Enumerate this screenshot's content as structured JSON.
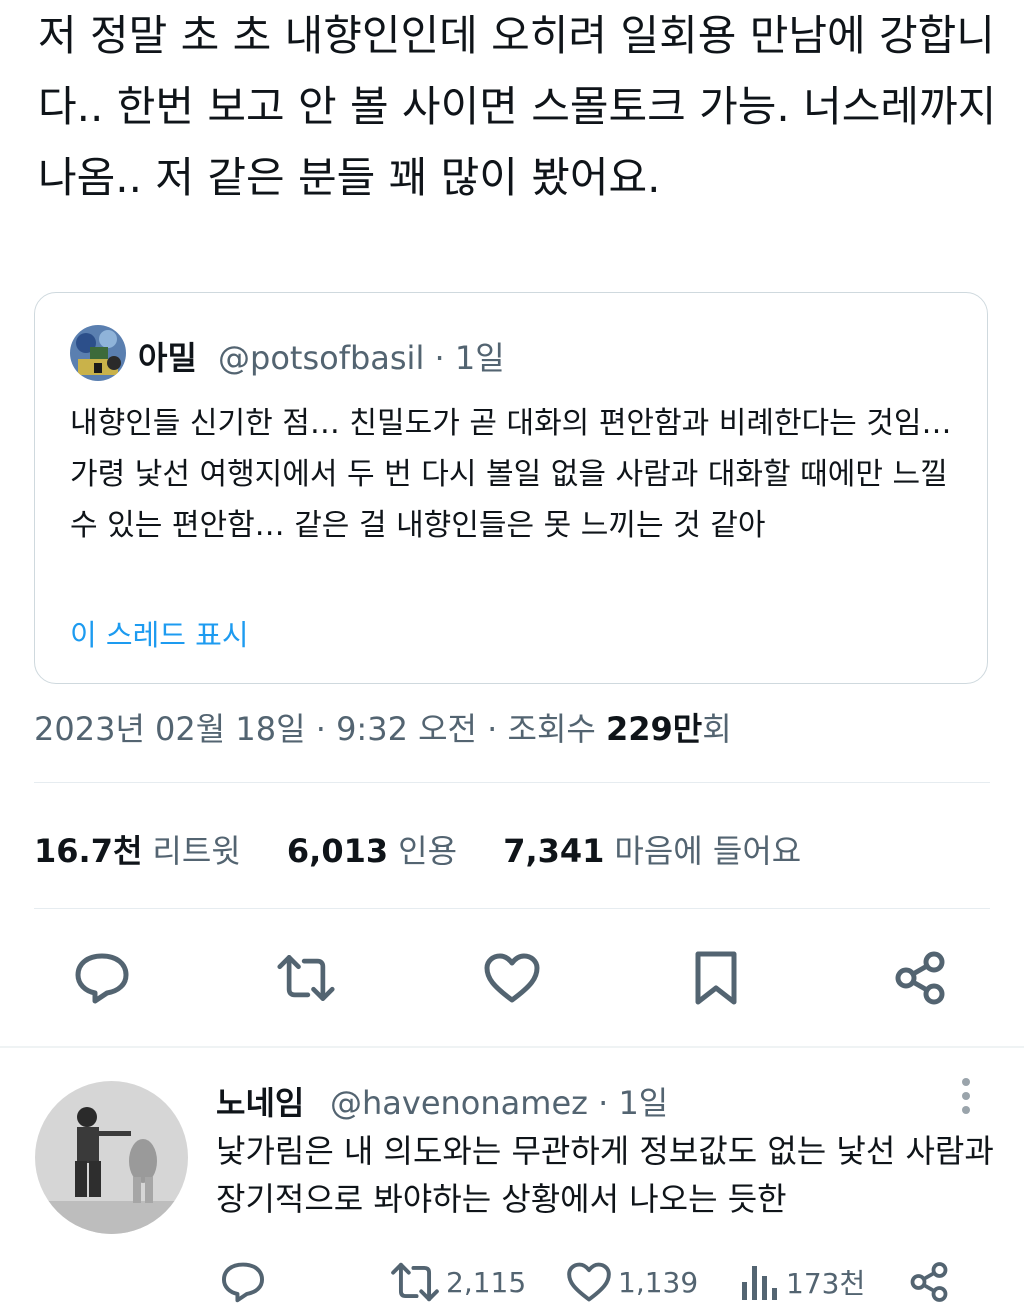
{
  "tweet": {
    "text": "저 정말 초 초 내향인인데 오히려 일회용 만남에 강합니다.. 한번 보고 안 볼 사이면 스몰토크 가능. 너스레까지 나옴.. 저 같은 분들 꽤 많이 봤어요.",
    "date": "2023년 02월 18일",
    "time": "9:32 오전",
    "views_label": "조회수",
    "views_value": "229만",
    "views_suffix": "회",
    "separator": "·"
  },
  "quote": {
    "name": "아밀",
    "handle": "@potsofbasil",
    "age": "1일",
    "text": "내향인들 신기한 점… 친밀도가 곧 대화의 편안함과 비례한다는 것임… 가령 낯선 여행지에서 두 번 다시 볼일 없을 사람과 대화할 때에만 느낄 수 있는 편안함… 같은 걸 내향인들은 못 느끼는 것 같아",
    "show_thread": "이 스레드 표시"
  },
  "stats": {
    "retweets": {
      "value": "16.7천",
      "label": "리트윗"
    },
    "quotes": {
      "value": "6,013",
      "label": "인용"
    },
    "likes": {
      "value": "7,341",
      "label": "마음에 들어요"
    }
  },
  "actions": {
    "icons": [
      "reply-icon",
      "retweet-icon",
      "like-icon",
      "bookmark-icon",
      "share-icon"
    ]
  },
  "reply": {
    "name": "노네임",
    "handle": "@havenonamez",
    "age": "1일",
    "text": "낯가림은 내 의도와는 무관하게 정보값도 없는 낯선 사람과 장기적으로 봐야하는 상황에서 나오는 듯한",
    "retweets": "2,115",
    "likes": "1,139",
    "views": "173천"
  },
  "colors": {
    "text": "#0f1419",
    "secondary": "#536471",
    "link": "#1d9bf0",
    "border": "#cfd9de"
  }
}
